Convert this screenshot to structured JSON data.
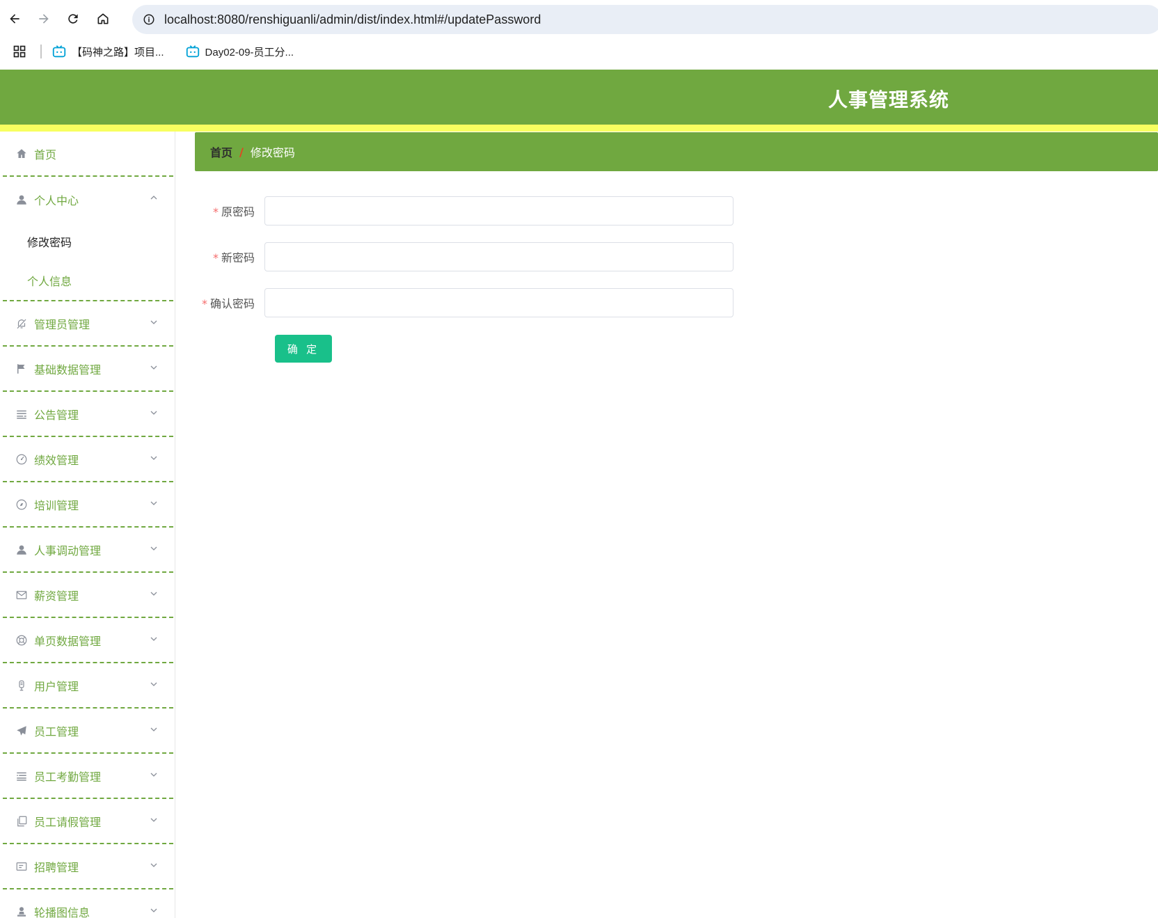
{
  "browser": {
    "url": "localhost:8080/renshiguanli/admin/dist/index.html#/updatePassword",
    "bookmarks": [
      {
        "label": "【码神之路】项目..."
      },
      {
        "label": "Day02-09-员工分..."
      }
    ]
  },
  "header": {
    "title": "人事管理系统",
    "color": "#70a840",
    "strip_color": "#f7ff60"
  },
  "sidebar": {
    "home": "首页",
    "personal": {
      "label": "个人中心",
      "items": [
        "修改密码",
        "个人信息"
      ]
    },
    "menus": [
      {
        "label": "管理员管理",
        "icon": "bell-off-icon"
      },
      {
        "label": "基础数据管理",
        "icon": "flag-icon"
      },
      {
        "label": "公告管理",
        "icon": "list-icon"
      },
      {
        "label": "绩效管理",
        "icon": "gauge-icon"
      },
      {
        "label": "培训管理",
        "icon": "compass-icon"
      },
      {
        "label": "人事调动管理",
        "icon": "user-icon"
      },
      {
        "label": "薪资管理",
        "icon": "mail-icon"
      },
      {
        "label": "单页数据管理",
        "icon": "lifebuoy-icon"
      },
      {
        "label": "用户管理",
        "icon": "microphone-icon"
      },
      {
        "label": "员工管理",
        "icon": "send-icon"
      },
      {
        "label": "员工考勤管理",
        "icon": "list-icon"
      },
      {
        "label": "员工请假管理",
        "icon": "copy-icon"
      },
      {
        "label": "招聘管理",
        "icon": "card-icon"
      },
      {
        "label": "轮播图信息",
        "icon": "user-stamp-icon"
      }
    ]
  },
  "breadcrumb": {
    "home": "首页",
    "separator": "/",
    "current": "修改密码"
  },
  "form": {
    "old_password": {
      "label": "原密码",
      "value": ""
    },
    "new_password": {
      "label": "新密码",
      "value": ""
    },
    "confirm_password": {
      "label": "确认密码",
      "value": ""
    },
    "submit_label": "确 定",
    "required_mark": "*"
  }
}
